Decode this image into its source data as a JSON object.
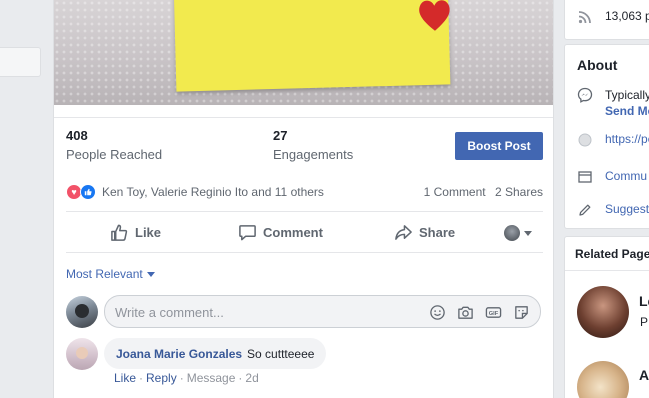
{
  "post": {
    "stats": {
      "reached_count": "408",
      "reached_label": "People Reached",
      "engagements_count": "27",
      "engagements_label": "Engagements",
      "boost_label": "Boost Post"
    },
    "reactions": {
      "icons": [
        "love-react-icon",
        "like-react-icon"
      ],
      "names": "Ken Toy, Valerie Reginio Ito and 11 others",
      "comment_count": "1 Comment",
      "share_count": "2 Shares"
    },
    "actions": {
      "like_label": "Like",
      "comment_label": "Comment",
      "share_label": "Share"
    },
    "comments": {
      "sort_label": "Most Relevant",
      "input_placeholder": "Write a comment...",
      "input_icons": [
        "emoji-icon",
        "camera-icon",
        "gif-icon",
        "sticker-icon"
      ],
      "items": [
        {
          "author": "Joana Marie Gonzales",
          "text": "So cuttteeee",
          "meta_like": "Like",
          "meta_reply": "Reply",
          "meta_message": "Message",
          "meta_time": "2d"
        }
      ]
    }
  },
  "sidebar": {
    "followers_text": "13,063 p",
    "about": {
      "title": "About",
      "messenger_line1": "Typically",
      "messenger_line2": "Send Me",
      "website": "https://pe",
      "community": "Commu",
      "suggest": "Suggest"
    },
    "related": {
      "title": "Related Page",
      "items": [
        {
          "name": "Le",
          "subtitle": "P"
        },
        {
          "name": "A"
        }
      ]
    }
  },
  "colors": {
    "brand_blue": "#4267b2",
    "link_blue": "#385898",
    "love_red": "#f25268",
    "like_blue": "#1877f2",
    "sticky_yellow": "#f2ea4e",
    "heart_red": "#d42a2a"
  }
}
